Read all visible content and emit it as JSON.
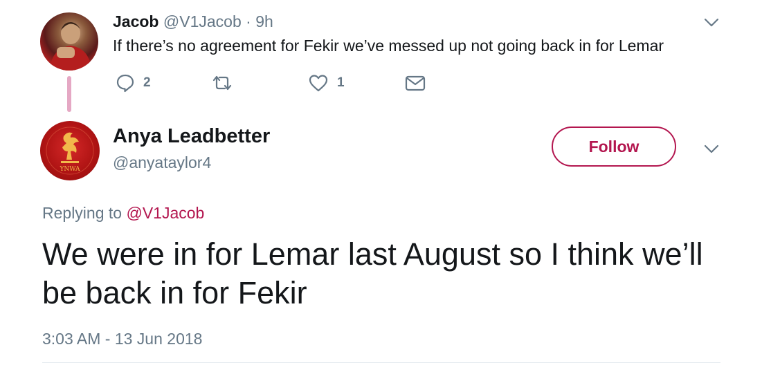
{
  "parent_tweet": {
    "display_name": "Jacob",
    "handle": "@V1Jacob",
    "separator": "·",
    "time": "9h",
    "text": "If there’s no agreement for Fekir we’ve messed up not going back in for Lemar",
    "reply_count": "2",
    "retweet_count": "",
    "like_count": "1"
  },
  "reply_tweet": {
    "display_name": "Anya Leadbetter",
    "handle": "@anyataylor4",
    "follow_label": "Follow",
    "replying_prefix": "Replying to",
    "replying_mention": "@V1Jacob",
    "text": "We were in for Lemar last August so I think we’ll be back in for Fekir",
    "timestamp": "3:03 AM - 13 Jun 2018",
    "avatar_caption": "YNWA"
  },
  "colors": {
    "accent": "#b3164f",
    "secondary_text": "#657786",
    "primary_text": "#14171a",
    "thread_line": "#e5a8c4"
  },
  "icons": [
    "reply-icon",
    "retweet-icon",
    "like-icon",
    "direct-message-icon",
    "chevron-down-icon"
  ]
}
